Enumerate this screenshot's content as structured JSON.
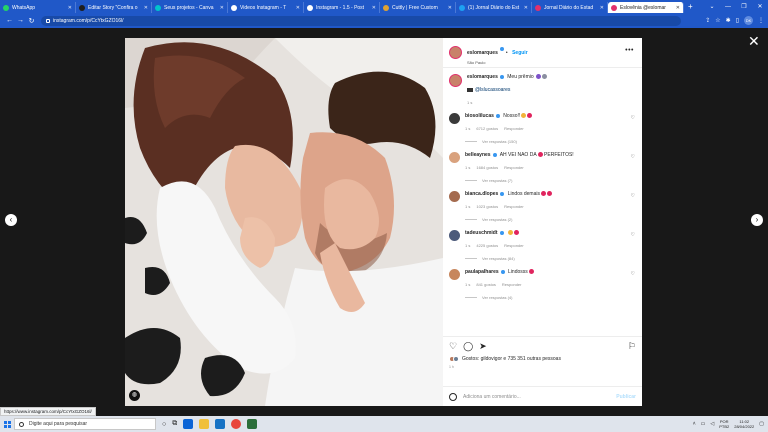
{
  "colors": {
    "chrome": "#2058c8",
    "accent_blue": "#0095f6",
    "heart_red": "#e0245e"
  },
  "browser": {
    "tabs": [
      {
        "label": "WhatsApp",
        "icon_color": "#25d366",
        "icon": "whatsapp-icon"
      },
      {
        "label": "Editar Story \"Confira o",
        "icon_color": "#1e1e1e",
        "icon": "editor-icon"
      },
      {
        "label": "Seus projetos - Canva",
        "icon_color": "#00c4cc",
        "icon": "canva-icon"
      },
      {
        "label": "Videos Instagram - T",
        "icon_color": "#ffffff",
        "icon": "globe-icon"
      },
      {
        "label": "Instagram - 1.5 - Post",
        "icon_color": "#ffffff",
        "icon": "globe-icon"
      },
      {
        "label": "Cuttly | Free Custom",
        "icon_color": "#e0a232",
        "icon": "cuttly-icon"
      },
      {
        "label": "(1) Jornal Diário do Est",
        "icon_color": "#1da1f2",
        "icon": "twitter-icon"
      },
      {
        "label": "Jornal Diário do Estad",
        "icon_color": "#e1306c",
        "icon": "instagram-icon"
      },
      {
        "label": "Eslovênia @eslomar",
        "icon_color": "#e1306c",
        "icon": "instagram-icon"
      }
    ],
    "url": "instagram.com/p/CcYtxGZO16l/",
    "profile_initials": "DK"
  },
  "post": {
    "author": "eslomarques",
    "follow_label": "Seguir",
    "location": "São Paulo",
    "caption": {
      "username": "eslomarques",
      "text": "Meu prêmio",
      "mention": "@lslucassoares",
      "time": "1 s"
    },
    "comments": [
      {
        "username": "biosolilucas",
        "text": "Nosso!!",
        "time": "1 s",
        "likes": "6712 gostos",
        "reply": "Responder",
        "replies": "Ver respostas (150)",
        "avatar_color": "#3a3a3a",
        "emojis": [
          "yel",
          "red"
        ]
      },
      {
        "username": "belleaynes",
        "text": "AH VEI NAO DA",
        "text_after": "PERFEITOS!",
        "time": "1 s",
        "likes": "1684 gostos",
        "reply": "Responder",
        "replies": "Ver respostas (7)",
        "avatar_color": "#d9a27e",
        "emojis": [
          "red"
        ]
      },
      {
        "username": "bianca.dlopes",
        "text": "Lindos demais",
        "time": "1 s",
        "likes": "1023 gostos",
        "reply": "Responder",
        "replies": "Ver respostas (2)",
        "avatar_color": "#a46b4f",
        "emojis": [
          "red",
          "red"
        ]
      },
      {
        "username": "tadeuschmidt",
        "text": "",
        "time": "1 s",
        "likes": "4225 gostos",
        "reply": "Responder",
        "replies": "Ver respostas (84)",
        "avatar_color": "#4c5a7a",
        "emojis": [
          "yel",
          "red"
        ]
      },
      {
        "username": "paulapalhares",
        "text": "Lindosss",
        "time": "1 s",
        "likes": "841 gostos",
        "reply": "Responder",
        "replies": "Ver respostas (4)",
        "avatar_color": "#c7865d",
        "emojis": [
          "red"
        ]
      }
    ],
    "likes_text": "Gostos: gildovigor e 735 351 outras pessoas",
    "date": "1 h",
    "add_comment_placeholder": "Adiciona um comentário...",
    "publish_label": "Publicar"
  },
  "status_url": "https://www.instagram.com/p/CcYtxGZO16l/",
  "taskbar": {
    "search_placeholder": "Digite aqui para pesquisar",
    "lang_line1": "POR",
    "lang_line2": "PTB2",
    "time": "11:02",
    "date": "28/04/2022"
  }
}
